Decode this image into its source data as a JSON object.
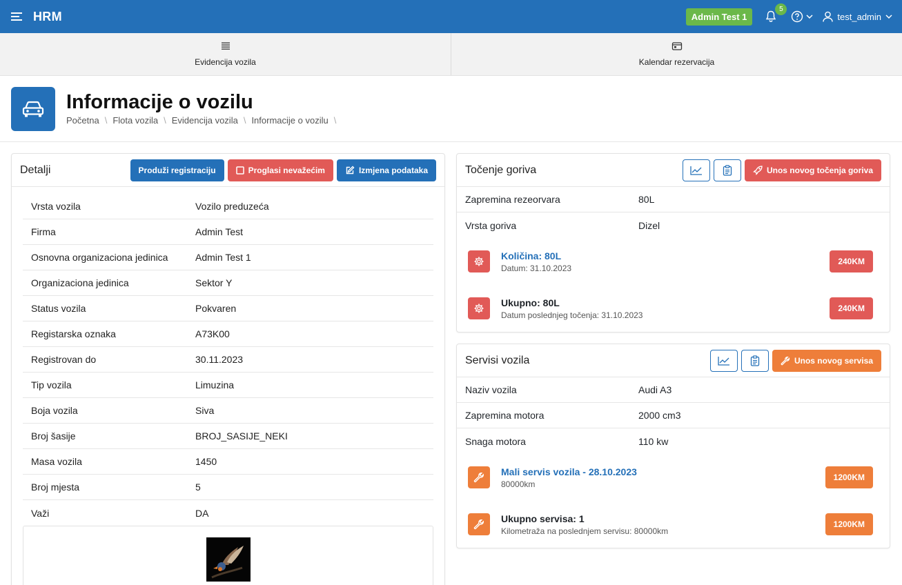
{
  "header": {
    "app_title": "HRM",
    "org_badge": "Admin Test 1",
    "notification_count": "5",
    "username": "test_admin"
  },
  "nav": {
    "tabs": [
      {
        "label": "Evidencija vozila",
        "icon": "list-icon"
      },
      {
        "label": "Kalendar rezervacija",
        "icon": "calendar-icon"
      }
    ]
  },
  "page": {
    "title": "Informacije o vozilu",
    "breadcrumb": [
      "Početna",
      "Flota vozila",
      "Evidencija vozila",
      "Informacije o vozilu"
    ],
    "icon": "car-icon"
  },
  "details": {
    "title": "Detalji",
    "buttons": {
      "extend": "Produži registraciju",
      "invalidate": "Proglasi nevažećim",
      "edit": "Izmjena podataka"
    },
    "rows": [
      {
        "label": "Vrsta vozila",
        "value": "Vozilo preduzeća"
      },
      {
        "label": "Firma",
        "value": "Admin Test"
      },
      {
        "label": "Osnovna organizaciona jedinica",
        "value": "Admin Test 1"
      },
      {
        "label": "Organizaciona jedinica",
        "value": "Sektor Y"
      },
      {
        "label": "Status vozila",
        "value": "Pokvaren"
      },
      {
        "label": "Registarska oznaka",
        "value": "A73K00"
      },
      {
        "label": "Registrovan do",
        "value": "30.11.2023"
      },
      {
        "label": "Tip vozila",
        "value": "Limuzina"
      },
      {
        "label": "Boja vozila",
        "value": "Siva"
      },
      {
        "label": "Broj šasije",
        "value": "BROJ_SASIJE_NEKI"
      },
      {
        "label": "Masa vozila",
        "value": "1450"
      },
      {
        "label": "Broj mjesta",
        "value": "5"
      },
      {
        "label": "Važi",
        "value": "DA"
      }
    ]
  },
  "fuel": {
    "title": "Točenje goriva",
    "add_button": "Unos novog točenja goriva",
    "rows": [
      {
        "label": "Zapremina rezeorvara",
        "value": "80L"
      },
      {
        "label": "Vrsta goriva",
        "value": "Dizel"
      }
    ],
    "stats": [
      {
        "title": "Količina: 80L",
        "subtitle": "Datum: 31.10.2023",
        "badge": "240KM"
      },
      {
        "title": "Ukupno: 80L",
        "subtitle": "Datum poslednjeg točenja: 31.10.2023",
        "badge": "240KM"
      }
    ]
  },
  "service": {
    "title": "Servisi vozila",
    "add_button": "Unos novog servisa",
    "rows": [
      {
        "label": "Naziv vozila",
        "value": "Audi A3"
      },
      {
        "label": "Zapremina motora",
        "value": "2000 cm3"
      },
      {
        "label": "Snaga motora",
        "value": "110 kw"
      }
    ],
    "stats": [
      {
        "title": "Mali servis vozila - 28.10.2023",
        "subtitle": "80000km",
        "badge": "1200KM"
      },
      {
        "title": "Ukupno servisa: 1",
        "subtitle": "Kilometraža na poslednjem servisu: 80000km",
        "badge": "1200KM"
      }
    ]
  },
  "colors": {
    "primary": "#2470b8",
    "danger": "#e15a57",
    "warning": "#ee7e3a",
    "success": "#6bb84a"
  }
}
